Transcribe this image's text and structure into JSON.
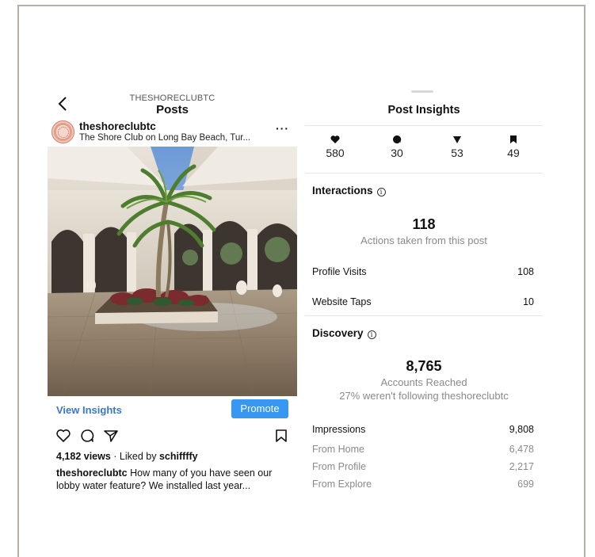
{
  "left_panel": {
    "account_label": "THESHORECLUBTC",
    "title": "Posts",
    "username": "theshoreclubtc",
    "location": "The Shore Club on Long Bay Beach, Tur...",
    "more_label": "···",
    "view_insights_label": "View Insights",
    "promote_label": "Promote",
    "views": "4,182 views",
    "liked_prefix": "· Liked by",
    "liked_by": "schiffffy",
    "caption_user": "theshoreclubtc",
    "caption_text": "How many of you have seen our lobby water feature? We installed last year..."
  },
  "right_panel": {
    "title": "Post Insights",
    "stats": [
      {
        "icon": "heart-icon",
        "value": "580"
      },
      {
        "icon": "comment-icon",
        "value": "30"
      },
      {
        "icon": "share-icon",
        "value": "53"
      },
      {
        "icon": "bookmark-icon",
        "value": "49"
      }
    ],
    "interactions": {
      "title": "Interactions",
      "total": "118",
      "subtitle": "Actions taken from this post",
      "rows": [
        {
          "label": "Profile Visits",
          "value": "108"
        },
        {
          "label": "Website Taps",
          "value": "10"
        }
      ]
    },
    "discovery": {
      "title": "Discovery",
      "total": "8,765",
      "subtitle": "Accounts Reached",
      "note": "27% weren't following theshoreclubtc",
      "impressions_label": "Impressions",
      "impressions_value": "9,808",
      "rows": [
        {
          "label": "From Home",
          "value": "6,478"
        },
        {
          "label": "From Profile",
          "value": "2,217"
        },
        {
          "label": "From Explore",
          "value": "699"
        }
      ]
    }
  },
  "colors": {
    "frame_border": "#b9aea5",
    "link_blue": "#3a77c9",
    "promote_blue": "#3897f0",
    "muted_text": "#8a8a8a"
  }
}
